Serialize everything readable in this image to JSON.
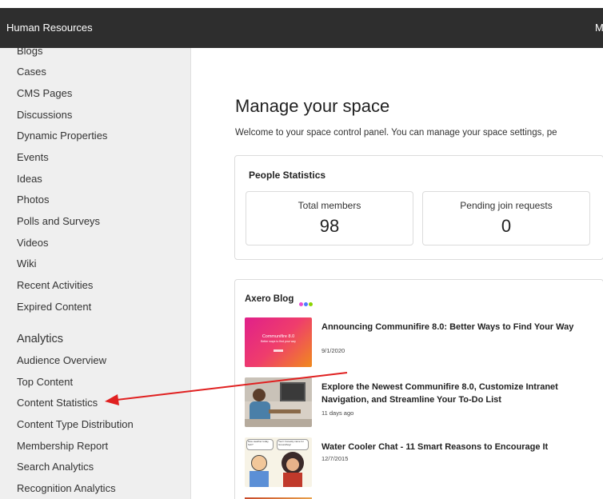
{
  "header": {
    "title": "Human Resources",
    "right_text": "M"
  },
  "sidebar": {
    "items": [
      "Blogs",
      "Cases",
      "CMS Pages",
      "Discussions",
      "Dynamic Properties",
      "Events",
      "Ideas",
      "Photos",
      "Polls and Surveys",
      "Videos",
      "Wiki",
      "Recent Activities",
      "Expired Content"
    ],
    "analytics_heading": "Analytics",
    "analytics_items": [
      "Audience Overview",
      "Top Content",
      "Content Statistics",
      "Content Type Distribution",
      "Membership Report",
      "Search Analytics",
      "Recognition Analytics"
    ]
  },
  "main": {
    "title": "Manage your space",
    "description": "Welcome to your space control panel. You can manage your space settings, pe",
    "people_stats": {
      "title": "People Statistics",
      "total_members_label": "Total members",
      "total_members_value": "98",
      "pending_label": "Pending join requests",
      "pending_value": "0"
    },
    "blog": {
      "title": "Axero Blog",
      "dot_colors": [
        "#e84fd0",
        "#4f7bff",
        "#8bd400"
      ],
      "posts": [
        {
          "title": "Announcing Communifire 8.0: Better Ways to Find Your Way",
          "date": "9/1/2020",
          "thumb_text": "Communifire 8.0",
          "thumb_sub": "Better ways to find your way"
        },
        {
          "title": "Explore the Newest Communifire 8.0, Customize Intranet Navigation, and Streamline Your To-Do List",
          "date": "11 days ago"
        },
        {
          "title": "Water Cooler Chat - 11 Smart Reasons to Encourage It",
          "date": "12/7/2015",
          "bubble1": "Nice weather today, huh?",
          "bubble2": "Yes! I honestly came for Groundhog!"
        }
      ]
    }
  },
  "colors": {
    "topbar": "#2e2e2e",
    "sidebar": "#efefef",
    "arrow": "#e02020"
  }
}
